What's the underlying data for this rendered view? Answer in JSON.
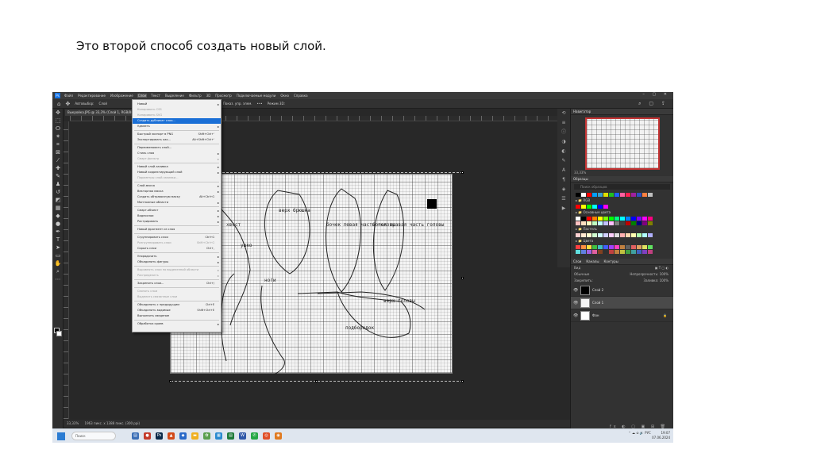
{
  "slide": {
    "title": "Это второй способ создать новый слой."
  },
  "menubar": {
    "items": [
      "Файл",
      "Редактирование",
      "Изображение",
      "Слои",
      "Текст",
      "Выделение",
      "Фильтр",
      "3D",
      "Просмотр",
      "Подключаемые модули",
      "Окно",
      "Справка"
    ],
    "active_index": 3,
    "window_controls": "–  ▢  ✕"
  },
  "options_bar": {
    "auto_label": "Автовыбор:",
    "auto_value": "Слой",
    "transform_label": "Показ. упр. элем.",
    "mode_3d": "Режим 3D:",
    "more": "•••"
  },
  "document_tab": "Выкройка.JPG @ 33,3% (Слой 1, RGB/8#)",
  "dropdown": {
    "items": [
      {
        "label": "Новый",
        "arrow": true
      },
      {
        "label": "Копировать CSS",
        "disabled": true
      },
      {
        "label": "Копировать SVG",
        "disabled": true
      },
      {
        "label": "Создать дубликат слоя...",
        "highlight": true
      },
      {
        "label": "Удалить",
        "arrow": true
      },
      {
        "sep": true
      },
      {
        "label": "Быстрый экспорт в PNG",
        "shortcut": "Shift+Ctrl+'"
      },
      {
        "label": "Экспортировать как...",
        "shortcut": "Alt+Shift+Ctrl+'"
      },
      {
        "sep": true
      },
      {
        "label": "Переименовать слой..."
      },
      {
        "label": "Стиль слоя",
        "arrow": true
      },
      {
        "label": "Смарт-фильтр",
        "arrow": true,
        "disabled": true
      },
      {
        "sep": true
      },
      {
        "label": "Новый слой-заливка",
        "arrow": true
      },
      {
        "label": "Новый корректирующий слой",
        "arrow": true
      },
      {
        "label": "Параметры слой-заливки...",
        "disabled": true
      },
      {
        "sep": true
      },
      {
        "label": "Слой-маска",
        "arrow": true
      },
      {
        "label": "Векторная маска",
        "arrow": true
      },
      {
        "label": "Создать обтравочную маску",
        "shortcut": "Alt+Ctrl+G"
      },
      {
        "label": "Монтажные области",
        "arrow": true
      },
      {
        "sep": true
      },
      {
        "label": "Смарт-объект",
        "arrow": true
      },
      {
        "label": "Видеослои",
        "arrow": true
      },
      {
        "label": "Растрировать",
        "arrow": true
      },
      {
        "sep": true
      },
      {
        "label": "Новый фрагмент из слоя"
      },
      {
        "sep": true
      },
      {
        "label": "Сгруппировать слои",
        "shortcut": "Ctrl+G"
      },
      {
        "label": "Разгруппировать слои",
        "shortcut": "Shift+Ctrl+G",
        "disabled": true
      },
      {
        "label": "Скрыть слои",
        "shortcut": "Ctrl+,"
      },
      {
        "sep": true
      },
      {
        "label": "Упорядочить",
        "arrow": true
      },
      {
        "label": "Объединить фигуры",
        "arrow": true
      },
      {
        "sep": true
      },
      {
        "label": "Выровнять слои по выделенной области",
        "arrow": true,
        "disabled": true
      },
      {
        "label": "Распределить",
        "arrow": true,
        "disabled": true
      },
      {
        "sep": true
      },
      {
        "label": "Закрепить слои...",
        "shortcut": "Ctrl+/"
      },
      {
        "sep": true
      },
      {
        "label": "Связать слои",
        "disabled": true
      },
      {
        "label": "Выделить связанные слои",
        "disabled": true
      },
      {
        "sep": true
      },
      {
        "label": "Объединить с предыдущим",
        "shortcut": "Ctrl+E"
      },
      {
        "label": "Объединить видимые",
        "shortcut": "Shift+Ctrl+E"
      },
      {
        "label": "Выполнить сведение"
      },
      {
        "sep": true
      },
      {
        "label": "Обработка краев",
        "arrow": true
      }
    ]
  },
  "canvas_labels": [
    "хвост",
    "верх брюшка",
    "бочек левая часть головы",
    "бочек правая часть головы",
    "ушко",
    "ноги",
    "верх головы",
    "подбородок"
  ],
  "status_bar": {
    "zoom": "33,33%",
    "size": "1963 пикс. x 1388 пикс. (300 ppi)"
  },
  "panels": {
    "navigator_title": "Навигатор",
    "swatches_title": "Образцы",
    "search_placeholder": "Поиск образцов",
    "folders": [
      "RGB",
      "Основные цвета",
      "Пастель",
      "Цвета"
    ],
    "layers_tabs": [
      "Слои",
      "Каналы",
      "Контуры"
    ],
    "kind_label": "Вид",
    "blend_mode": "Обычные",
    "opacity_label": "Непрозрачность:",
    "opacity_value": "100%",
    "lock_label": "Закрепить:",
    "fill_label": "Заливка:",
    "fill_value": "100%",
    "layers": [
      {
        "name": "Слой 2",
        "thumb": "#000000",
        "selected": false
      },
      {
        "name": "Слой 1",
        "thumb": "#f4f4f4",
        "selected": true
      },
      {
        "name": "Фон",
        "thumb": "#ffffff",
        "selected": false,
        "locked": true
      }
    ],
    "footer_icons": "fx ◐ ▢ ▣ ⊞ 🗑"
  },
  "taskbar": {
    "search_placeholder": "Поиск",
    "language": "РУС",
    "time": "19:07",
    "date": "07.06.2024"
  },
  "colors": {
    "accent_highlight": "#1a6fd6",
    "ps_dark": "#282828",
    "navigator_frame": "#c43434"
  }
}
